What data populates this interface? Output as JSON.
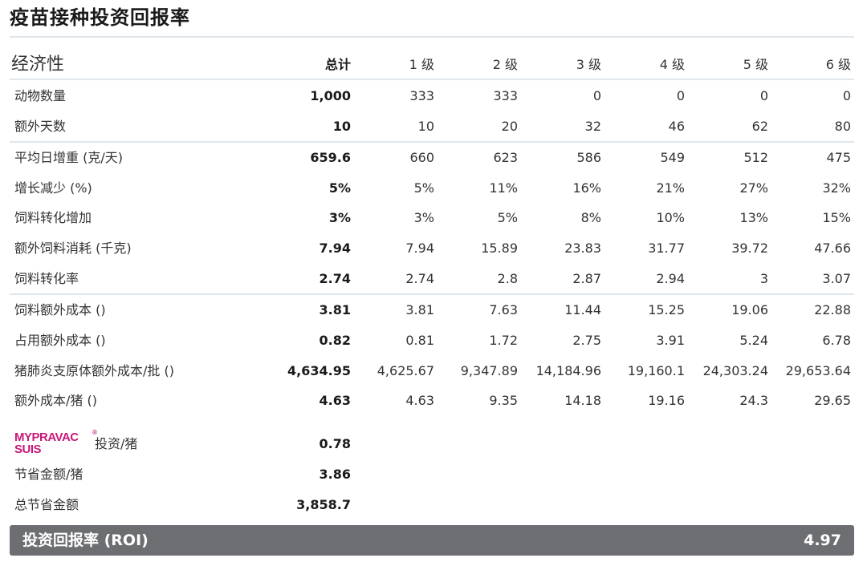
{
  "title": "疫苗接种投资回报率",
  "header": {
    "label": "经济性",
    "cols": [
      "总计",
      "1 级",
      "2 级",
      "3 级",
      "4 级",
      "5 级",
      "6 级"
    ]
  },
  "rows": [
    {
      "label": "动物数量",
      "values": [
        "1,000",
        "333",
        "333",
        "0",
        "0",
        "0",
        "0"
      ]
    },
    {
      "label": "额外天数",
      "values": [
        "10",
        "10",
        "20",
        "32",
        "46",
        "62",
        "80"
      ]
    },
    {
      "label": "平均日增重 (克/天)",
      "values": [
        "659.6",
        "660",
        "623",
        "586",
        "549",
        "512",
        "475"
      ]
    },
    {
      "label": "增长减少 (%)",
      "values": [
        "5%",
        "5%",
        "11%",
        "16%",
        "21%",
        "27%",
        "32%"
      ]
    },
    {
      "label": "饲料转化增加",
      "values": [
        "3%",
        "3%",
        "5%",
        "8%",
        "10%",
        "13%",
        "15%"
      ]
    },
    {
      "label": "额外饲料消耗 (千克)",
      "values": [
        "7.94",
        "7.94",
        "15.89",
        "23.83",
        "31.77",
        "39.72",
        "47.66"
      ]
    },
    {
      "label": "饲料转化率",
      "values": [
        "2.74",
        "2.74",
        "2.8",
        "2.87",
        "2.94",
        "3",
        "3.07"
      ]
    },
    {
      "label": "饲料额外成本 ()",
      "values": [
        "3.81",
        "3.81",
        "7.63",
        "11.44",
        "15.25",
        "19.06",
        "22.88"
      ]
    },
    {
      "label": "占用额外成本 ()",
      "values": [
        "0.82",
        "0.81",
        "1.72",
        "2.75",
        "3.91",
        "5.24",
        "6.78"
      ]
    },
    {
      "label": "猪肺炎支原体额外成本/批 ()",
      "values": [
        "4,634.95",
        "4,625.67",
        "9,347.89",
        "14,184.96",
        "19,160.1",
        "24,303.24",
        "29,653.64"
      ]
    },
    {
      "label": "额外成本/猪 ()",
      "values": [
        "4.63",
        "4.63",
        "9.35",
        "14.18",
        "19.16",
        "24.3",
        "29.65"
      ]
    }
  ],
  "summary": {
    "brand_line1": "MYPRAVAC",
    "brand_line2": "SUIS",
    "brand_reg": "®",
    "invest_label": "投资/猪",
    "invest_value": "0.78",
    "saving_label": "节省金额/猪",
    "saving_value": "3.86",
    "total_saving_label": "总节省金额",
    "total_saving_value": "3,858.7"
  },
  "roi": {
    "label": "投资回报率 (ROI)",
    "value": "4.97"
  },
  "colors": {
    "brand": "#c8197a",
    "roi_bar": "#6d6e71",
    "rule": "#dfe6ec"
  }
}
